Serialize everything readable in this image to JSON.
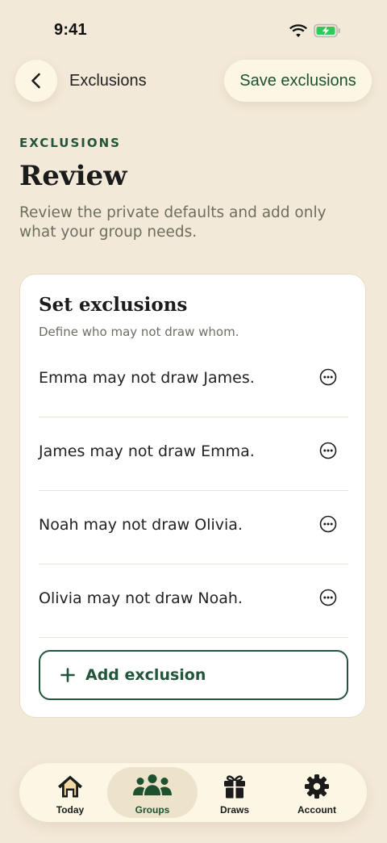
{
  "status_bar": {
    "time": "9:41"
  },
  "header": {
    "title": "Exclusions",
    "save_label": "Save exclusions"
  },
  "page": {
    "eyebrow": "EXCLUSIONS",
    "title": "Review",
    "subtitle": "Review the private defaults and add only what your group needs."
  },
  "card": {
    "title": "Set exclusions",
    "subtitle": "Define who may not draw whom.",
    "exclusions": [
      "Emma may not draw James.",
      "James may not draw Emma.",
      "Noah may not draw Olivia.",
      "Olivia may not draw Noah."
    ],
    "add_label": "Add exclusion"
  },
  "tab_bar": {
    "active": "Groups",
    "tabs": [
      {
        "label": "Today",
        "icon": "home-icon"
      },
      {
        "label": "Groups",
        "icon": "people-icon"
      },
      {
        "label": "Draws",
        "icon": "gift-icon"
      },
      {
        "label": "Account",
        "icon": "gear-icon"
      }
    ]
  },
  "colors": {
    "background": "#f3e9d8",
    "accent": "#22553a",
    "surface": "#fcf6e4",
    "active_tab": "#ede3cb"
  }
}
